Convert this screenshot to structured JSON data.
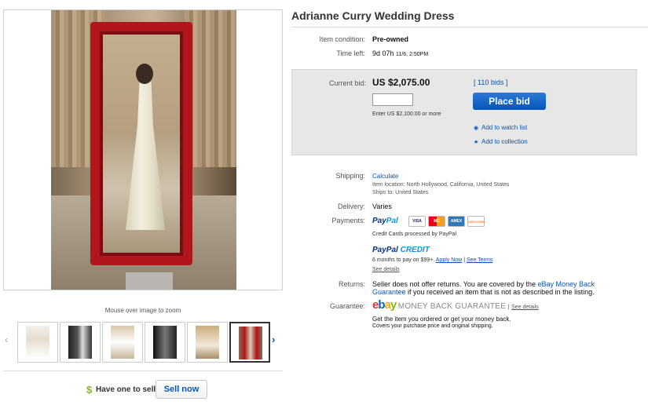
{
  "colors": {
    "link": "#0654ba",
    "bid_button": "#0654ba",
    "frame_red": "#b0161b",
    "panel_bg": "#e7e7e7",
    "sell_icon": "#86b817"
  },
  "gallery": {
    "zoom_hint": "Mouse over image to zoom",
    "prev_icon": "chevron-left-icon",
    "next_icon": "chevron-right-icon",
    "thumbnails": 6,
    "active_thumbnail": 6
  },
  "sell": {
    "icon": "dollar-icon",
    "dollar": "$",
    "prompt": "Have one to sell?",
    "button": "Sell now"
  },
  "item": {
    "title": "Adrianne Curry Wedding Dress",
    "condition_label": "Item condition:",
    "condition_value": "Pre-owned",
    "time_left_label": "Time left:",
    "time_left_value": "9d 07h",
    "time_left_end": "11/6, 2:50PM"
  },
  "bid": {
    "label": "Current bid:",
    "amount": "US $2,075.00",
    "bids_link": "[ 110 bids ]",
    "input_value": "",
    "min_text": "Enter US $2,100.00 or more",
    "place_bid": "Place bid",
    "watch_icon": "eye-icon",
    "watch": "Add to watch list",
    "collection_icon": "star-icon",
    "collection": "Add to collection"
  },
  "shipping": {
    "label": "Shipping:",
    "calculate": "Calculate",
    "location": "Item location:  North Hollywood, California, United States",
    "ships_to": "Ships to:  United States"
  },
  "delivery": {
    "label": "Delivery:",
    "value": "Varies"
  },
  "payments": {
    "label": "Payments:",
    "paypal_a": "Pay",
    "paypal_b": "Pal",
    "cards": [
      "VISA",
      "MC",
      "AMEX",
      "DISCOVER"
    ],
    "processed": "Credit Cards processed by PayPal",
    "credit_a": "PayPal",
    "credit_b": "CREDIT",
    "credit_terms": "6 months to pay on $99+.",
    "apply": "Apply Now",
    "sep": "|",
    "see_terms": "See Terms",
    "details": "See details"
  },
  "returns": {
    "label": "Returns:",
    "text_a": "Seller does not offer returns. You are covered by the",
    "link_a": "eBay Money Back",
    "link_b": "Guarantee",
    "text_b": "if you received an item that is not as described in the listing."
  },
  "guarantee": {
    "label": "Guarantee:",
    "logo_e": "e",
    "logo_b": "b",
    "logo_a": "a",
    "logo_y": "y",
    "mbg": "MONEY BACK GUARANTEE",
    "sep": "|",
    "details": "See details",
    "line1": "Get the item you ordered or get your money back.",
    "line2": "Covers your purchase price and original shipping."
  }
}
